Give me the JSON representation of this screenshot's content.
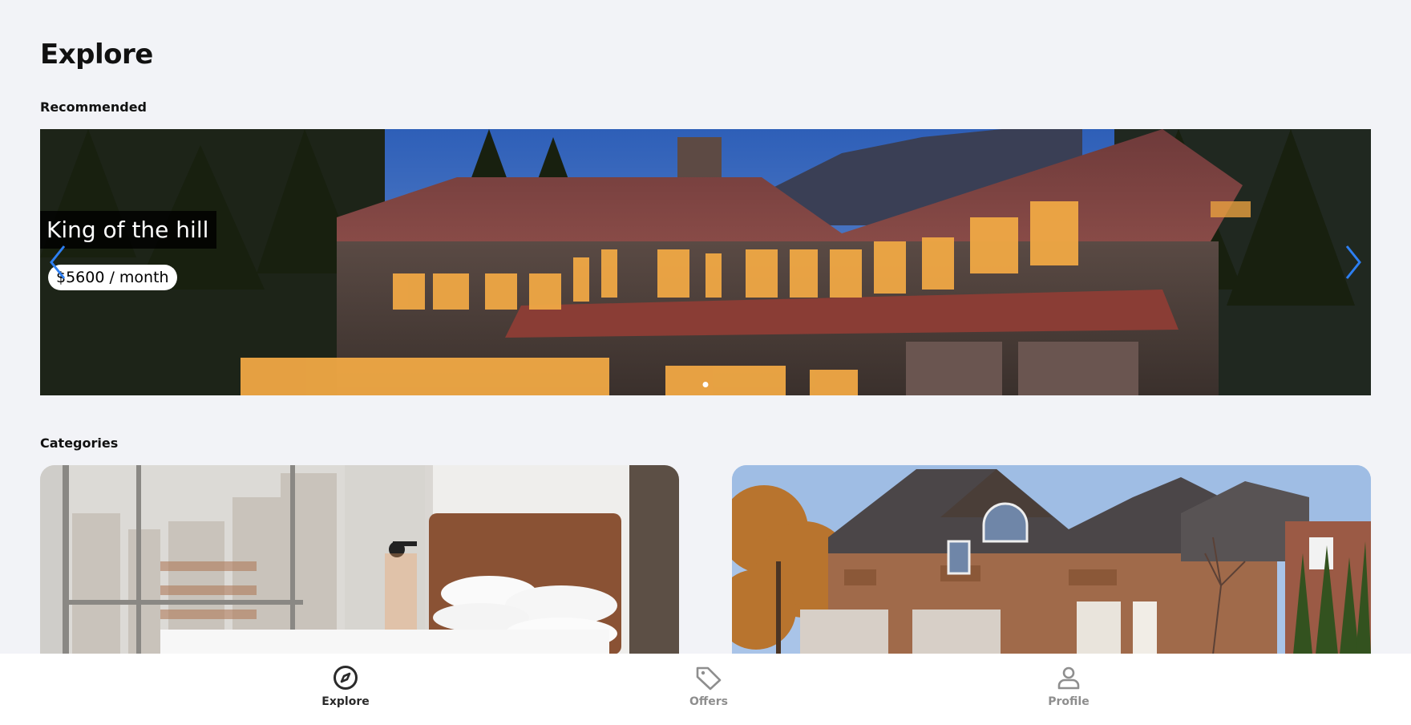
{
  "header": {
    "title": "Explore"
  },
  "sections": {
    "recommended": "Recommended",
    "categories": "Categories"
  },
  "carousel": {
    "slide_title": "King of the hill",
    "slide_price": "$5600 / month",
    "active_index": 0,
    "arrow_color": "#2d7ff2"
  },
  "categories": [
    {
      "image": "bedroom-photo"
    },
    {
      "image": "house-exterior-photo"
    }
  ],
  "nav": {
    "items": [
      {
        "label": "Explore",
        "icon": "compass-icon",
        "active": true
      },
      {
        "label": "Offers",
        "icon": "tag-icon",
        "active": false
      },
      {
        "label": "Profile",
        "icon": "person-icon",
        "active": false
      }
    ]
  },
  "colors": {
    "background": "#f2f3f7",
    "accent": "#2d7ff2"
  }
}
